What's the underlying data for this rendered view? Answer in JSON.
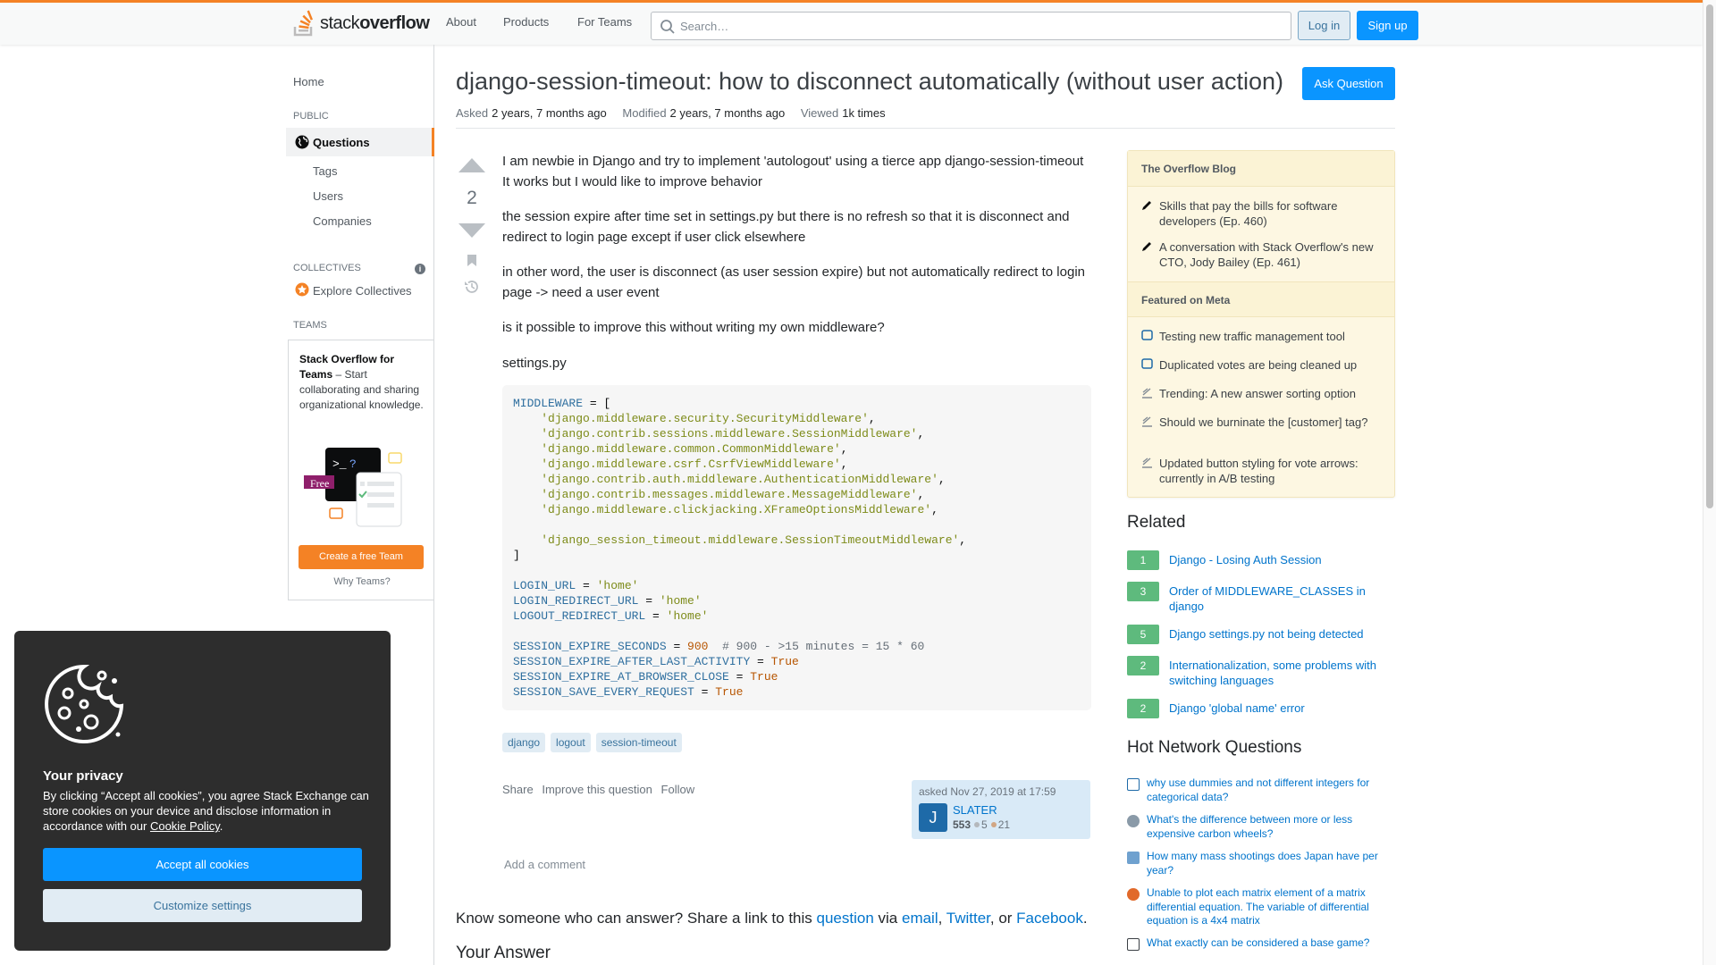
{
  "header": {
    "logo_text_light": "stack",
    "logo_text_bold": "overflow",
    "nav": [
      "About",
      "Products",
      "For Teams"
    ],
    "search_placeholder": "Search…",
    "login_label": "Log in",
    "signup_label": "Sign up"
  },
  "sidebar": {
    "home": "Home",
    "public_label": "PUBLIC",
    "questions": "Questions",
    "tags": "Tags",
    "users": "Users",
    "companies": "Companies",
    "collectives_label": "COLLECTIVES",
    "explore_collectives": "Explore Collectives",
    "teams_label": "TEAMS",
    "teams_promo_bold": "Stack Overflow for Teams",
    "teams_promo_rest": " – Start collaborating and sharing organizational knowledge.",
    "teams_free_badge": "Free",
    "teams_button": "Create a free Team",
    "teams_why": "Why Teams?"
  },
  "question": {
    "title": "django-session-timeout: how to disconnect automatically (without user action)",
    "ask_button": "Ask Question",
    "asked_label": "Asked",
    "asked_value": "2 years, 7 months ago",
    "modified_label": "Modified",
    "modified_value": "2 years, 7 months ago",
    "viewed_label": "Viewed",
    "viewed_value": "1k times",
    "votes": "2",
    "paragraphs": [
      "I am newbie in Django and try to implement 'autologout' using a tierce app django-session-timeout It works but I would like to improve behavior",
      "the session expire after time set in settings.py but there is no refresh so that it is disconnect and redirect to login page except if user click elsewhere",
      "in other word, the user is disconnect (as user session expire) but not automatically redirect to login page -> need a user event",
      "is it possible to improve this without writing my own middleware?",
      "settings.py"
    ],
    "tags": [
      "django",
      "logout",
      "session-timeout"
    ],
    "actions": [
      "Share",
      "Improve this question",
      "Follow"
    ],
    "asked_on": "asked Nov 27, 2019 at 17:59",
    "user_initial": "J",
    "user_name": "SLATER",
    "user_rep": "553",
    "user_silver": "5",
    "user_bronze": "21",
    "add_comment": "Add a comment",
    "share_prefix": "Know someone who can answer? Share a link to this ",
    "share_question": "question",
    "share_via": " via ",
    "share_email": "email",
    "share_comma1": ", ",
    "share_twitter": "Twitter",
    "share_or": ", or ",
    "share_facebook": "Facebook",
    "share_end": ".",
    "your_answer": "Your Answer"
  },
  "blog": {
    "overflow_blog_title": "The Overflow Blog",
    "blog_items": [
      "Skills that pay the bills for software developers (Ep. 460)",
      "A conversation with Stack Overflow's new CTO, Jody Bailey (Ep. 461)"
    ],
    "meta_title": "Featured on Meta",
    "meta_items": [
      "Testing new traffic management tool",
      "Duplicated votes are being cleaned up",
      "Trending: A new answer sorting option",
      "Should we burninate the [customer] tag?",
      "Updated button styling for vote arrows: currently in A/B testing"
    ]
  },
  "related": {
    "title": "Related",
    "items": [
      {
        "score": "1",
        "text": "Django - Losing Auth Session"
      },
      {
        "score": "3",
        "text": "Order of MIDDLEWARE_CLASSES in django"
      },
      {
        "score": "5",
        "text": "Django settings.py not being detected"
      },
      {
        "score": "2",
        "text": "Internationalization, some problems with switching languages"
      },
      {
        "score": "2",
        "text": "Django 'global name' error"
      }
    ]
  },
  "hnq": {
    "title": "Hot Network Questions",
    "items": [
      "why use dummies and not different integers for categorical data?",
      "What's the difference between more or less expensive carbon wheels?",
      "How many mass shootings does Japan have per year?",
      "Unable to plot each matrix element of a matrix differential equation. The variable of differential equation is a 4x4 matrix",
      "What exactly can be considered a base game?"
    ]
  },
  "cookie": {
    "title": "Your privacy",
    "text_prefix": "By clicking “Accept all cookies”, you agree Stack Exchange can store cookies on your device and disclose information in accordance with our ",
    "policy_link": "Cookie Policy",
    "text_suffix": ".",
    "accept": "Accept all cookies",
    "customize": "Customize settings"
  },
  "colors": {
    "accent_orange": "#f48225",
    "primary_blue": "#0a95ff",
    "link_blue": "#0074cc",
    "answer_green": "#5eba7d",
    "cookie_bg": "#2d2d2d"
  }
}
